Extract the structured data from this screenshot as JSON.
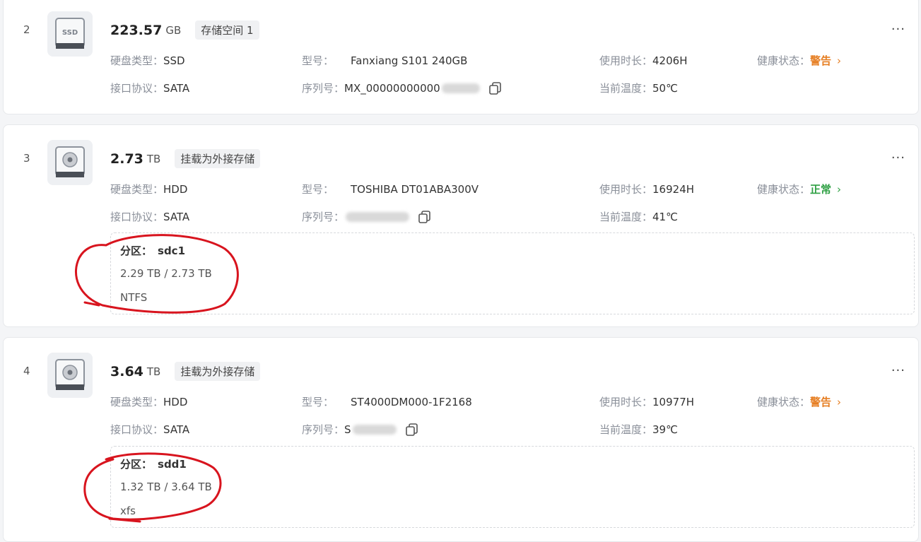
{
  "labels": {
    "type": "硬盘类型：",
    "iface": "接口协议：",
    "model": "型号：",
    "serial": "序列号：",
    "hours": "使用时长：",
    "temp": "当前温度：",
    "health": "健康状态：",
    "partition": "分区："
  },
  "disks": [
    {
      "index": "2",
      "icon": "ssd-icon",
      "capacity": "223.57",
      "unit": "GB",
      "tag": "存储空间 1",
      "type": "SSD",
      "iface": "SATA",
      "model": "Fanxiang S101 240GB",
      "serial_visible": "MX_00000000000",
      "hours": "4206H",
      "temp": "50℃",
      "health": "警告",
      "health_color": "#e67e22"
    },
    {
      "index": "3",
      "icon": "hdd-icon",
      "capacity": "2.73",
      "unit": "TB",
      "tag": "挂载为外接存储",
      "type": "HDD",
      "iface": "SATA",
      "model": "TOSHIBA DT01ABA300V",
      "serial_visible": "",
      "hours": "16924H",
      "temp": "41℃",
      "health": "正常",
      "health_color": "#2ea043",
      "partition": {
        "name": "sdc1",
        "size": "2.29 TB / 2.73 TB",
        "fs": "NTFS"
      }
    },
    {
      "index": "4",
      "icon": "hdd-icon",
      "capacity": "3.64",
      "unit": "TB",
      "tag": "挂载为外接存储",
      "type": "HDD",
      "iface": "SATA",
      "model": "ST4000DM000-1F2168",
      "serial_visible": "S",
      "hours": "10977H",
      "temp": "39℃",
      "health": "警告",
      "health_color": "#e67e22",
      "partition": {
        "name": "sdd1",
        "size": "1.32 TB / 3.64 TB",
        "fs": "xfs"
      }
    }
  ],
  "more_glyph": "···",
  "chevron_glyph": "›",
  "annotation_color": "#d8141e"
}
